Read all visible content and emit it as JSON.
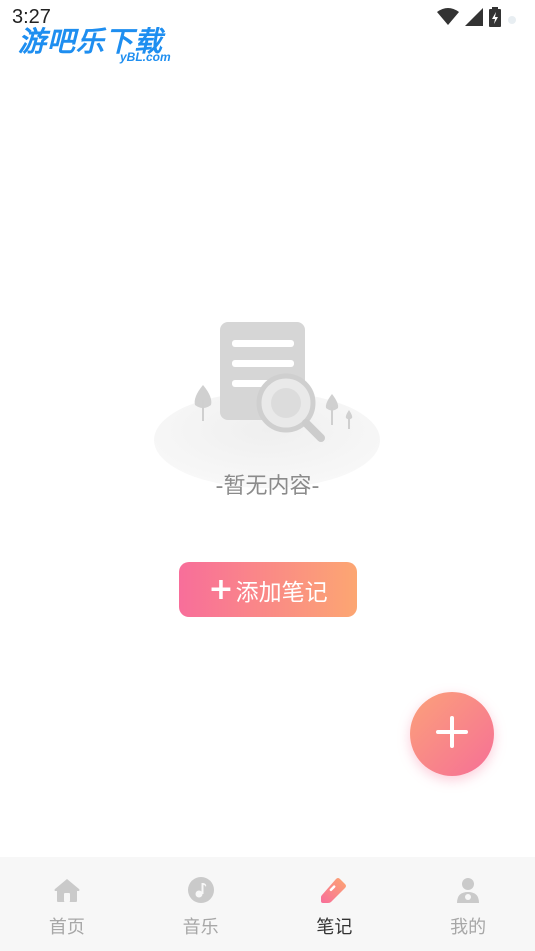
{
  "status_bar": {
    "time": "3:27",
    "icons": [
      "wifi-icon",
      "cell-signal-icon",
      "battery-icon"
    ]
  },
  "watermark": {
    "main": "游吧乐下载",
    "sub": "yBL.com"
  },
  "empty_state": {
    "text": "-暂无内容-",
    "illustration": "empty-document-search-illustration"
  },
  "add_note_button": {
    "plus": "+",
    "label": "添加笔记"
  },
  "fab": {
    "icon": "plus-icon"
  },
  "bottom_nav": {
    "active_index": 2,
    "items": [
      {
        "label": "首页",
        "icon": "home-icon"
      },
      {
        "label": "音乐",
        "icon": "music-icon"
      },
      {
        "label": "笔记",
        "icon": "note-edit-icon"
      },
      {
        "label": "我的",
        "icon": "user-icon"
      }
    ]
  },
  "colors": {
    "accent_start": "#f86e9a",
    "accent_end": "#fca672",
    "inactive": "#c9c9c9",
    "empty_text": "#8b8b8b"
  }
}
